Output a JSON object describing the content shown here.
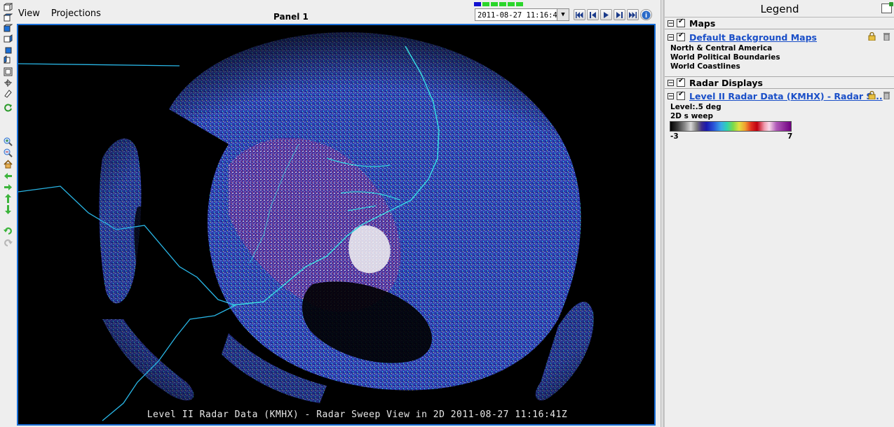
{
  "menu": {
    "view": "View",
    "projections": "Projections"
  },
  "panel": {
    "title": "Panel 1"
  },
  "animation": {
    "time": "2011-08-27 11:16:41Z",
    "steps_total": 6,
    "current_step": 1
  },
  "display": {
    "caption": "Level II Radar Data (KMHX) - Radar Sweep View in 2D 2011-08-27 11:16:41Z"
  },
  "legend": {
    "title": "Legend",
    "maps": {
      "label": "Maps",
      "layer": {
        "name": "Default Background Maps",
        "items": [
          "North & Central America",
          "World Political Boundaries",
          "World Coastlines"
        ]
      }
    },
    "radar": {
      "label": "Radar Displays",
      "layer": {
        "name": "Level II Radar Data (KMHX) - Radar S...",
        "level": "Level:.5 deg",
        "sweep": "2D s weep",
        "colorbar": {
          "min": "-3",
          "max": "7"
        }
      }
    }
  },
  "colors": {
    "accent": "#1a6fd8",
    "link": "#1a4fc8"
  }
}
